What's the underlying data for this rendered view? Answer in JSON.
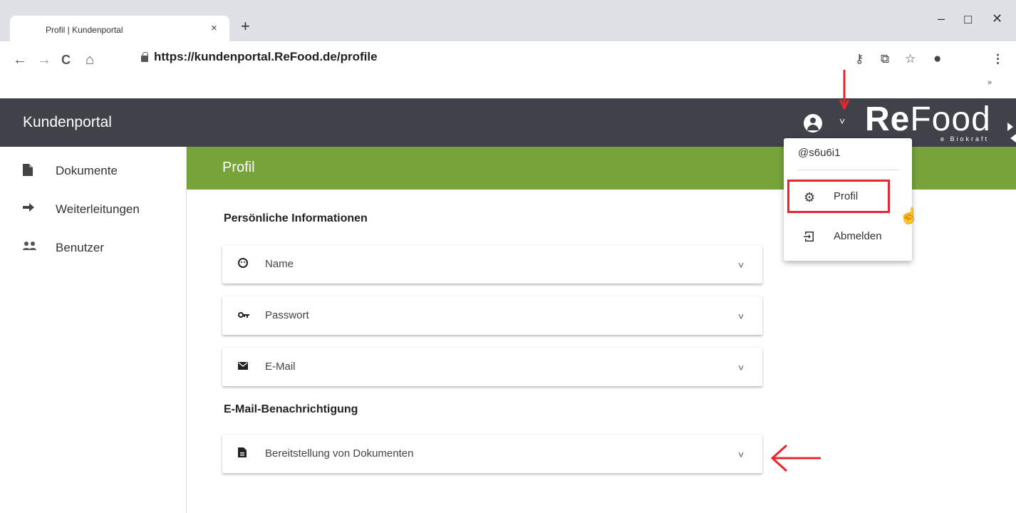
{
  "browser": {
    "tab_title": "Profil | Kundenportal",
    "tab_close": "×",
    "new_tab": "+",
    "win_min": "–",
    "win_max": "☐",
    "win_close": "✕",
    "nav_back": "←",
    "nav_forward": "→",
    "nav_reload": "C",
    "nav_home": "⌂",
    "url": "https://kundenportal.ReFood.de/profile",
    "overflow": "»"
  },
  "header": {
    "title": "Kundenportal",
    "user_chevron": "˅",
    "logo_re": "Re",
    "logo_food": "Food",
    "logo_tagline": "e Biokraft"
  },
  "sidebar": {
    "items": [
      {
        "label": "Dokumente",
        "icon": "document-icon"
      },
      {
        "label": "Weiterleitungen",
        "icon": "arrow-right-icon"
      },
      {
        "label": "Benutzer",
        "icon": "users-icon"
      }
    ]
  },
  "main": {
    "page_title": "Profil",
    "sections": [
      {
        "title": "Persönliche Informationen"
      },
      {
        "title": "E-Mail-Benachrichtigung"
      }
    ],
    "panels": [
      {
        "label": "Name",
        "icon": "face-icon"
      },
      {
        "label": "Passwort",
        "icon": "key-icon"
      },
      {
        "label": "E-Mail",
        "icon": "envelope-icon"
      },
      {
        "label": "Bereitstellung von Dokumenten",
        "icon": "document-icon"
      }
    ],
    "chevron": "˅"
  },
  "user_menu": {
    "username": "@s6u6i1",
    "items": [
      {
        "label": "Profil",
        "icon": "gear-icon"
      },
      {
        "label": "Abmelden",
        "icon": "logout-icon"
      }
    ]
  },
  "colors": {
    "header_bg": "#3f4248",
    "accent_green": "#76a33a",
    "annotation_red": "#e8262e"
  }
}
